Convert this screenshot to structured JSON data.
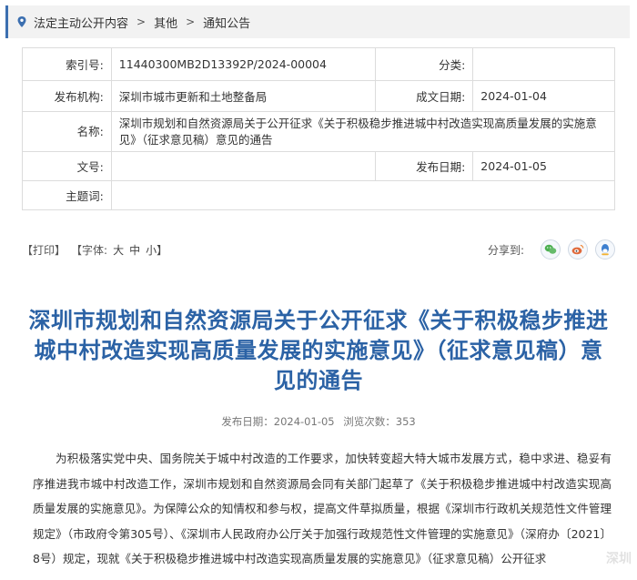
{
  "breadcrumb": {
    "items": [
      "法定主动公开内容",
      "其他",
      "通知公告"
    ],
    "separator": ">"
  },
  "meta": {
    "index_label": "索引号:",
    "index_value": "11440300MB2D13392P/2024-00004",
    "category_label": "分类:",
    "category_value": "",
    "publisher_label": "发布机构:",
    "publisher_value": "深圳市城市更新和土地整备局",
    "created_label": "成文日期:",
    "created_value": "2024-01-04",
    "name_label": "名称:",
    "name_value": "深圳市规划和自然资源局关于公开征求《关于积极稳步推进城中村改造实现高质量发展的实施意见》（征求意见稿）意见的通告",
    "docno_label": "文号:",
    "docno_value": "",
    "published_label": "发布日期:",
    "published_value": "2024-01-05",
    "subject_label": "主题词:",
    "subject_value": ""
  },
  "toolbar": {
    "print_label": "【打印】",
    "fontsize_label": "【字体:",
    "font_large": "大",
    "font_medium": "中",
    "font_small": "小】",
    "share_label": "分享到:",
    "share_icons": [
      "wechat-icon",
      "weibo-icon",
      "qq-icon"
    ],
    "accent_color": "#3c6fb0"
  },
  "article": {
    "title": "深圳市规划和自然资源局关于公开征求《关于积极稳步推进城中村改造实现高质量发展的实施意见》（征求意见稿）意见的通告",
    "date_label": "发布日期：",
    "date_value": "2024-01-05",
    "views_label": "浏览次数：",
    "views_value": "353",
    "paragraph": "为积极落实党中央、国务院关于城中村改造的工作要求，加快转变超大特大城市发展方式，稳中求进、稳妥有序推进我市城中村改造工作，深圳市规划和自然资源局会同有关部门起草了《关于积极稳步推进城中村改造实现高质量发展的实施意见》。为保障公众的知情权和参与权，提高文件草拟质量，根据《深圳市行政机关规范性文件管理规定》（市政府令第305号）、《深圳市人民政府办公厅关于加强行政规范性文件管理的实施意见》（深府办〔2021〕8号）规定，现就《关于积极稳步推进城中村改造实现高质量发展的实施意见》（征求意见稿）公开征求",
    "title_color": "#2b62a5"
  }
}
